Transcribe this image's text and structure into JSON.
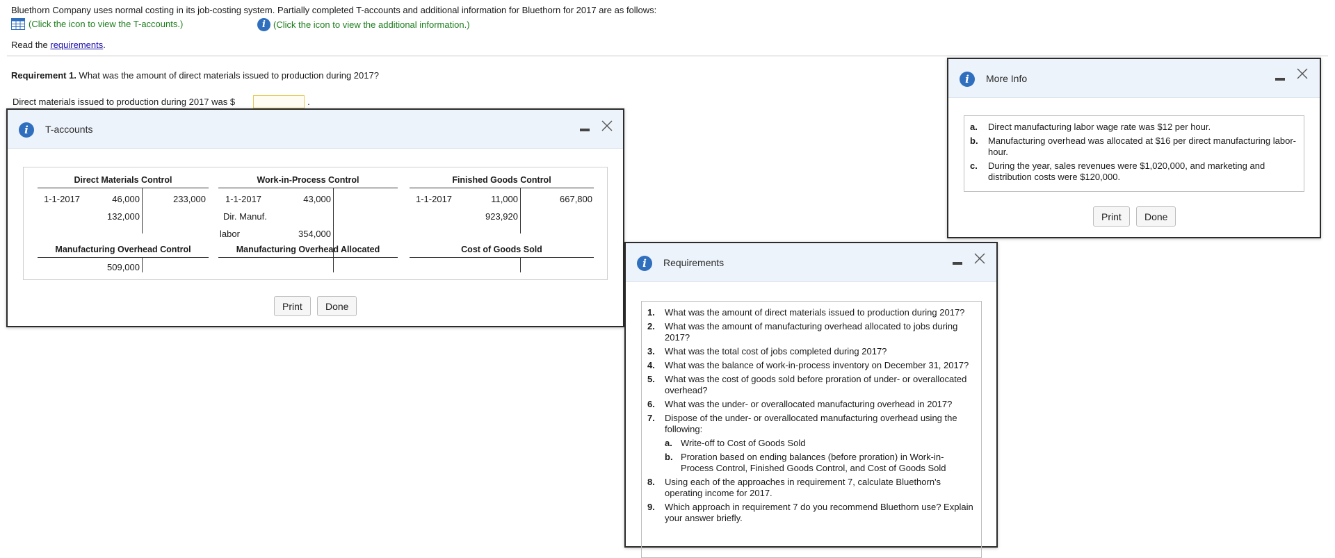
{
  "intro": "Bluethorn Company uses normal costing in its job-costing system. Partially completed T-accounts and additional information for Bluethorn for 2017 are as follows:",
  "links": {
    "taccounts": "(Click the icon to view the T-accounts.)",
    "info": "(Click the icon to view the additional information.)"
  },
  "read": {
    "prefix": "Read the ",
    "link": "requirements",
    "suffix": "."
  },
  "req1": {
    "label": "Requirement 1.",
    "question": "What was the amount of direct materials issued to production during 2017?",
    "answer_prefix": "Direct materials issued to production during 2017 was $",
    "answer_value": "",
    "answer_suffix": "."
  },
  "taccounts": {
    "title": "T-accounts",
    "accounts": {
      "dm": {
        "name": "Direct Materials Control",
        "rows": [
          {
            "label": "1-1-2017",
            "debit": "46,000",
            "credit": "233,000"
          },
          {
            "label": "",
            "debit": "132,000",
            "credit": ""
          }
        ]
      },
      "wip": {
        "name": "Work-in-Process Control",
        "rows": [
          {
            "label": "1-1-2017",
            "debit": "43,000"
          },
          {
            "label": "Dir. Manuf.",
            "debit": ""
          },
          {
            "label": "labor",
            "debit": "354,000"
          }
        ]
      },
      "fg": {
        "name": "Finished Goods Control",
        "rows": [
          {
            "label": "1-1-2017",
            "debit": "11,000",
            "credit": "667,800"
          },
          {
            "label": "",
            "debit": "923,920",
            "credit": ""
          }
        ]
      },
      "moh": {
        "name": "Manufacturing Overhead Control",
        "debit": "509,000"
      },
      "moha": {
        "name": "Manufacturing Overhead Allocated"
      },
      "cogs": {
        "name": "Cost of Goods Sold"
      }
    },
    "print": "Print",
    "done": "Done"
  },
  "moreinfo": {
    "title": "More Info",
    "items": [
      {
        "label": "a.",
        "text": "Direct manufacturing labor wage rate was $12 per hour."
      },
      {
        "label": "b.",
        "text": "Manufacturing overhead was allocated at $16 per direct manufacturing labor-hour."
      },
      {
        "label": "c.",
        "text": "During the year, sales revenues were $1,020,000, and marketing and distribution costs were $120,000."
      }
    ],
    "print": "Print",
    "done": "Done"
  },
  "requirements": {
    "title": "Requirements",
    "items": [
      {
        "num": "1.",
        "text": "What was the amount of direct materials issued to production during 2017?"
      },
      {
        "num": "2.",
        "text": "What was the amount of manufacturing overhead allocated to jobs during 2017?"
      },
      {
        "num": "3.",
        "text": "What was the total cost of jobs completed during 2017?"
      },
      {
        "num": "4.",
        "text": "What was the balance of work-in-process inventory on December 31, 2017?"
      },
      {
        "num": "5.",
        "text": "What was the cost of goods sold before proration of under- or overallocated overhead?"
      },
      {
        "num": "6.",
        "text": "What was the under- or overallocated manufacturing overhead in 2017?"
      },
      {
        "num": "7.",
        "text": "Dispose of the under- or overallocated manufacturing overhead using the following:"
      },
      {
        "num": "a.",
        "text": "Write-off to Cost of Goods Sold"
      },
      {
        "num": "b.",
        "text": "Proration based on ending balances (before proration) in Work-in-Process Control, Finished Goods Control, and Cost of Goods Sold"
      },
      {
        "num": "8.",
        "text": "Using each of the approaches in requirement 7, calculate Bluethorn's operating income for 2017."
      },
      {
        "num": "9.",
        "text": "Which approach in requirement 7 do you recommend Bluethorn use? Explain your answer briefly."
      }
    ]
  },
  "colors": {
    "accent": "#2f6fbe",
    "link_green": "#1b7d1b",
    "header_bg": "#edf3fb"
  },
  "icons": {
    "table": "table-icon",
    "info": "info-icon",
    "minimize": "minimize-icon",
    "close": "close-icon"
  }
}
